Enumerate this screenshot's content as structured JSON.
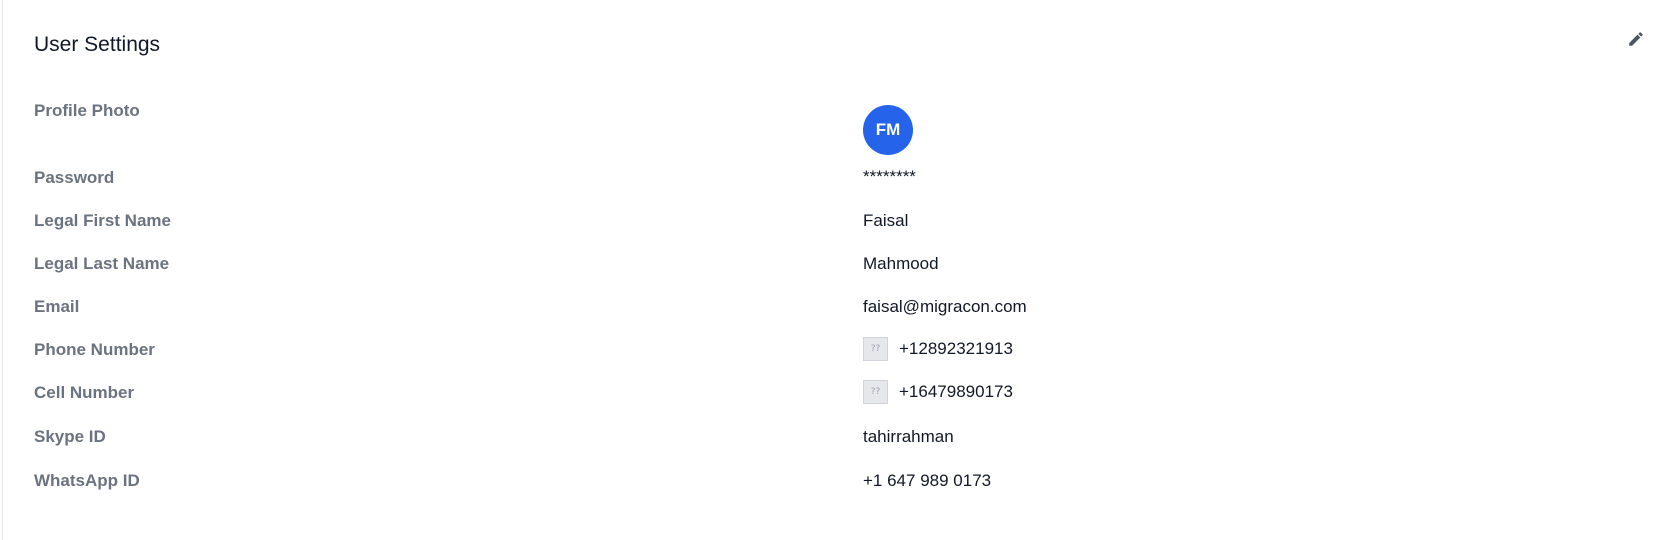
{
  "card": {
    "title": "User Settings"
  },
  "edit": {
    "icon": "pencil-icon"
  },
  "fields": {
    "profile_photo": {
      "label": "Profile Photo",
      "initials": "FM",
      "avatar_color": "#2563eb"
    },
    "password": {
      "label": "Password",
      "value": "********"
    },
    "first_name": {
      "label": "Legal First Name",
      "value": "Faisal"
    },
    "last_name": {
      "label": "Legal Last Name",
      "value": "Mahmood"
    },
    "email": {
      "label": "Email",
      "value": "faisal@migracon.com"
    },
    "phone": {
      "label": "Phone Number",
      "value": "+12892321913",
      "flag_glyph": "??"
    },
    "cell": {
      "label": "Cell Number",
      "value": "+16479890173",
      "flag_glyph": "??"
    },
    "skype": {
      "label": "Skype ID",
      "value": "tahirrahman"
    },
    "whatsapp": {
      "label": "WhatsApp ID",
      "value": "+1 647 989 0173"
    }
  }
}
